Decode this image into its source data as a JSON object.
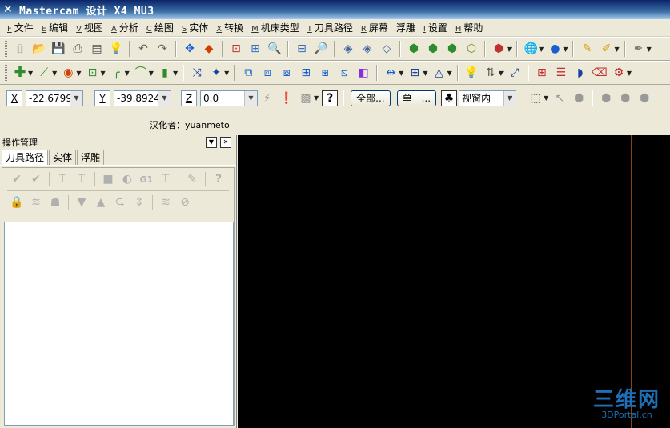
{
  "window": {
    "title": "Mastercam 设计 X4 MU3"
  },
  "menu": [
    {
      "accel": "F",
      "label": "文件"
    },
    {
      "accel": "E",
      "label": "编辑"
    },
    {
      "accel": "V",
      "label": "视图"
    },
    {
      "accel": "A",
      "label": "分析"
    },
    {
      "accel": "C",
      "label": "绘图"
    },
    {
      "accel": "S",
      "label": "实体"
    },
    {
      "accel": "X",
      "label": "转换"
    },
    {
      "accel": "M",
      "label": "机床类型"
    },
    {
      "accel": "T",
      "label": "刀具路径"
    },
    {
      "accel": "R",
      "label": "屏幕"
    },
    {
      "accel": "",
      "label": "浮雕"
    },
    {
      "accel": "I",
      "label": "设置"
    },
    {
      "accel": "H",
      "label": "帮助"
    }
  ],
  "coords": {
    "x_label": "X",
    "x_value": "-22.67999",
    "y_label": "Y",
    "y_value": "-39.89248",
    "z_label": "Z",
    "z_value": "0.0",
    "all_button": "全部...",
    "single_button": "单一...",
    "view_select": "视窗内"
  },
  "credit": "汉化者：yuanmeto",
  "panel": {
    "title": "操作管理",
    "tabs": [
      "刀具路径",
      "实体",
      "浮雕"
    ]
  },
  "watermark": {
    "main": "三维网",
    "sub": "3DPortal.cn"
  },
  "colors": {
    "viewport_bg": "#000000",
    "axis_line": "#8b4513",
    "watermark": "#1e6fb5"
  }
}
